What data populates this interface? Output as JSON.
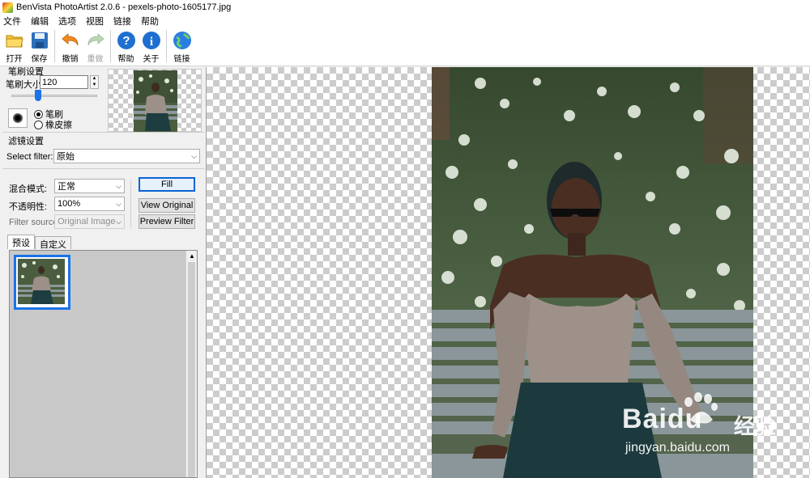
{
  "window": {
    "title": "BenVista PhotoArtist 2.0.6 - pexels-photo-1605177.jpg"
  },
  "menu": [
    "文件",
    "编辑",
    "选项",
    "视图",
    "链接",
    "帮助"
  ],
  "toolbar": {
    "open": "打开",
    "save": "保存",
    "undo": "撤销",
    "redo": "重做",
    "help": "帮助",
    "about": "关于",
    "link": "链接"
  },
  "brush_settings": {
    "group_title": "笔刷设置",
    "size_label": "笔刷大小:",
    "size_value": "120",
    "mode_brush": "笔刷",
    "mode_eraser": "橡皮擦",
    "selected_mode": "笔刷"
  },
  "filter_settings": {
    "group_title": "滤镜设置",
    "select_filter_label": "Select filter:",
    "select_filter_value": "原始",
    "blend_mode_label": "混合模式:",
    "blend_mode_value": "正常",
    "opacity_label": "不透明性:",
    "opacity_value": "100%",
    "filter_source_label": "Filter source:",
    "filter_source_value": "Original Image",
    "fill_button": "Fill",
    "view_original_button": "View Original",
    "preview_filter_button": "Preview Filter"
  },
  "tabs": {
    "presets": "预设",
    "custom": "自定义",
    "active": "预设"
  },
  "watermark": {
    "brand": "Bai",
    "brand_suffix": "du",
    "cn": "经验",
    "url": "jingyan.baidu.com"
  },
  "colors": {
    "accent": "#1a73e8",
    "checker": "#cccccc",
    "panel_bg": "#f0f0f0"
  }
}
